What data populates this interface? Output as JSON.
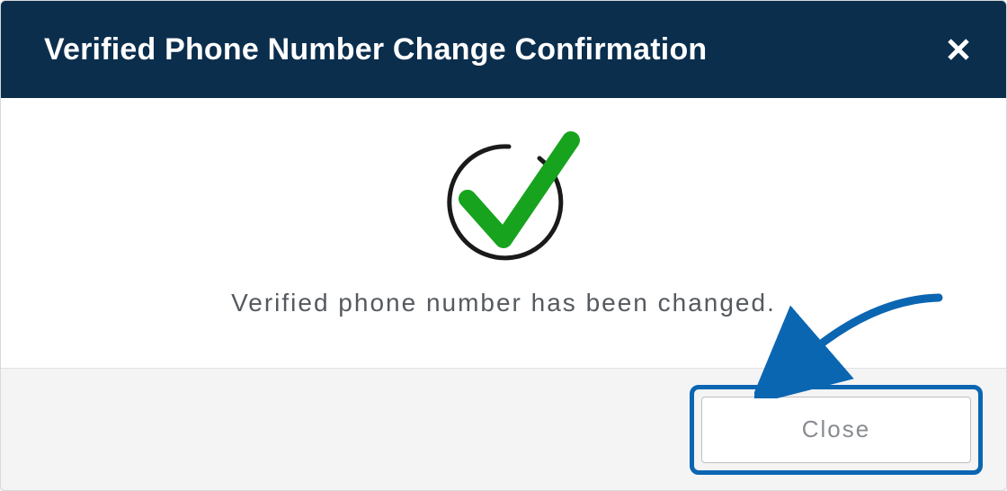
{
  "dialog": {
    "title": "Verified Phone Number Change Confirmation",
    "message": "Verified phone number has been changed.",
    "close_button_label": "Close"
  },
  "colors": {
    "header_bg": "#0b2e4d",
    "accent": "#0b66b2",
    "success": "#17a31d"
  }
}
